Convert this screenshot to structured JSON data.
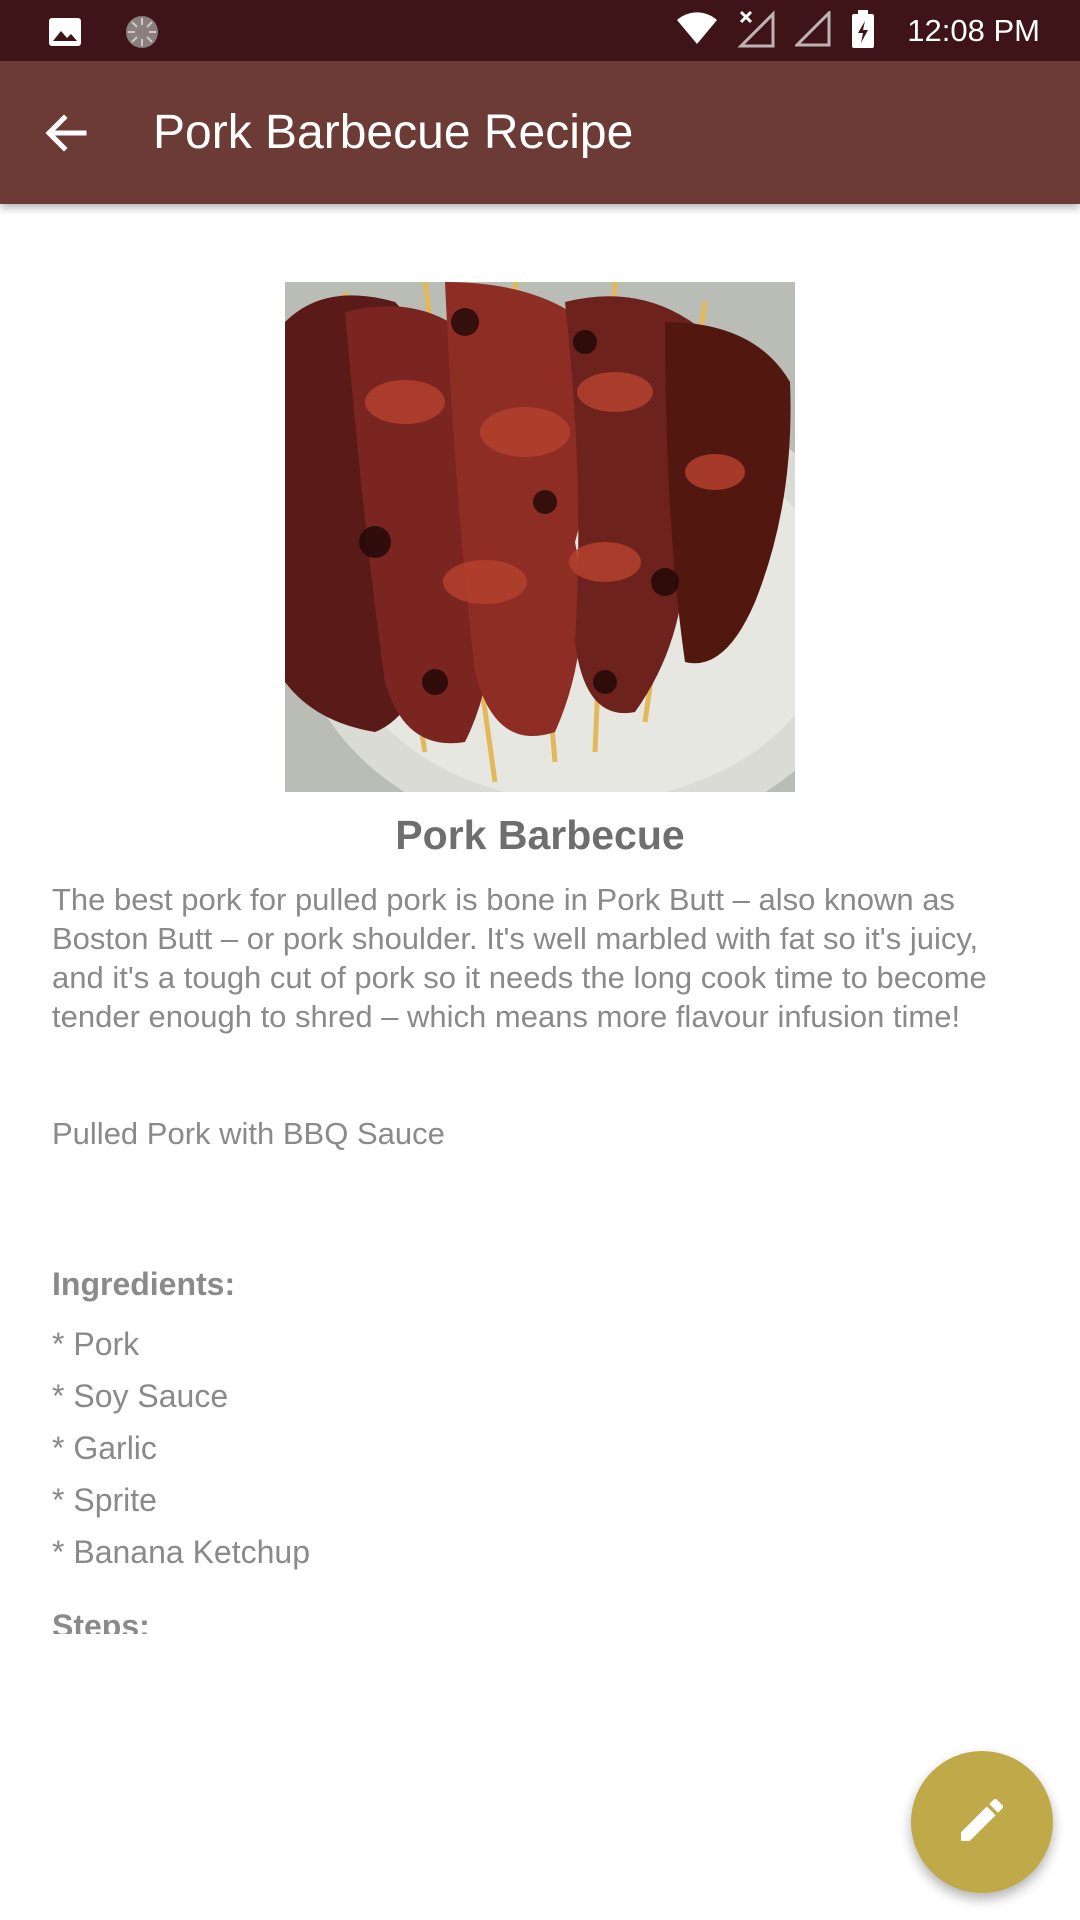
{
  "status_bar": {
    "time": "12:08 PM",
    "icons": [
      "image-icon",
      "loading-icon",
      "wifi-icon",
      "no-signal-icon",
      "signal-icon",
      "battery-charging-icon"
    ]
  },
  "app_bar": {
    "title": "Pork Barbecue Recipe",
    "back_icon": "arrow-back-icon",
    "color": "#6d3b35"
  },
  "recipe": {
    "title": "Pork Barbecue",
    "description": "The best pork for pulled pork is bone in Pork Butt – also known as Boston Butt – or pork shoulder. It's well marbled with fat so it's juicy, and it's a tough cut of pork so it needs the long cook time to become tender enough to shred – which means more flavour infusion time!",
    "subtitle": "Pulled Pork with BBQ Sauce",
    "ingredients_heading": "Ingredients:",
    "ingredients": [
      "* Pork",
      "* Soy Sauce",
      "* Garlic",
      "* Sprite",
      "* Banana Ketchup"
    ],
    "steps_heading": "Steps:"
  },
  "fab": {
    "icon": "edit-pencil-icon",
    "color": "#c0a948"
  }
}
